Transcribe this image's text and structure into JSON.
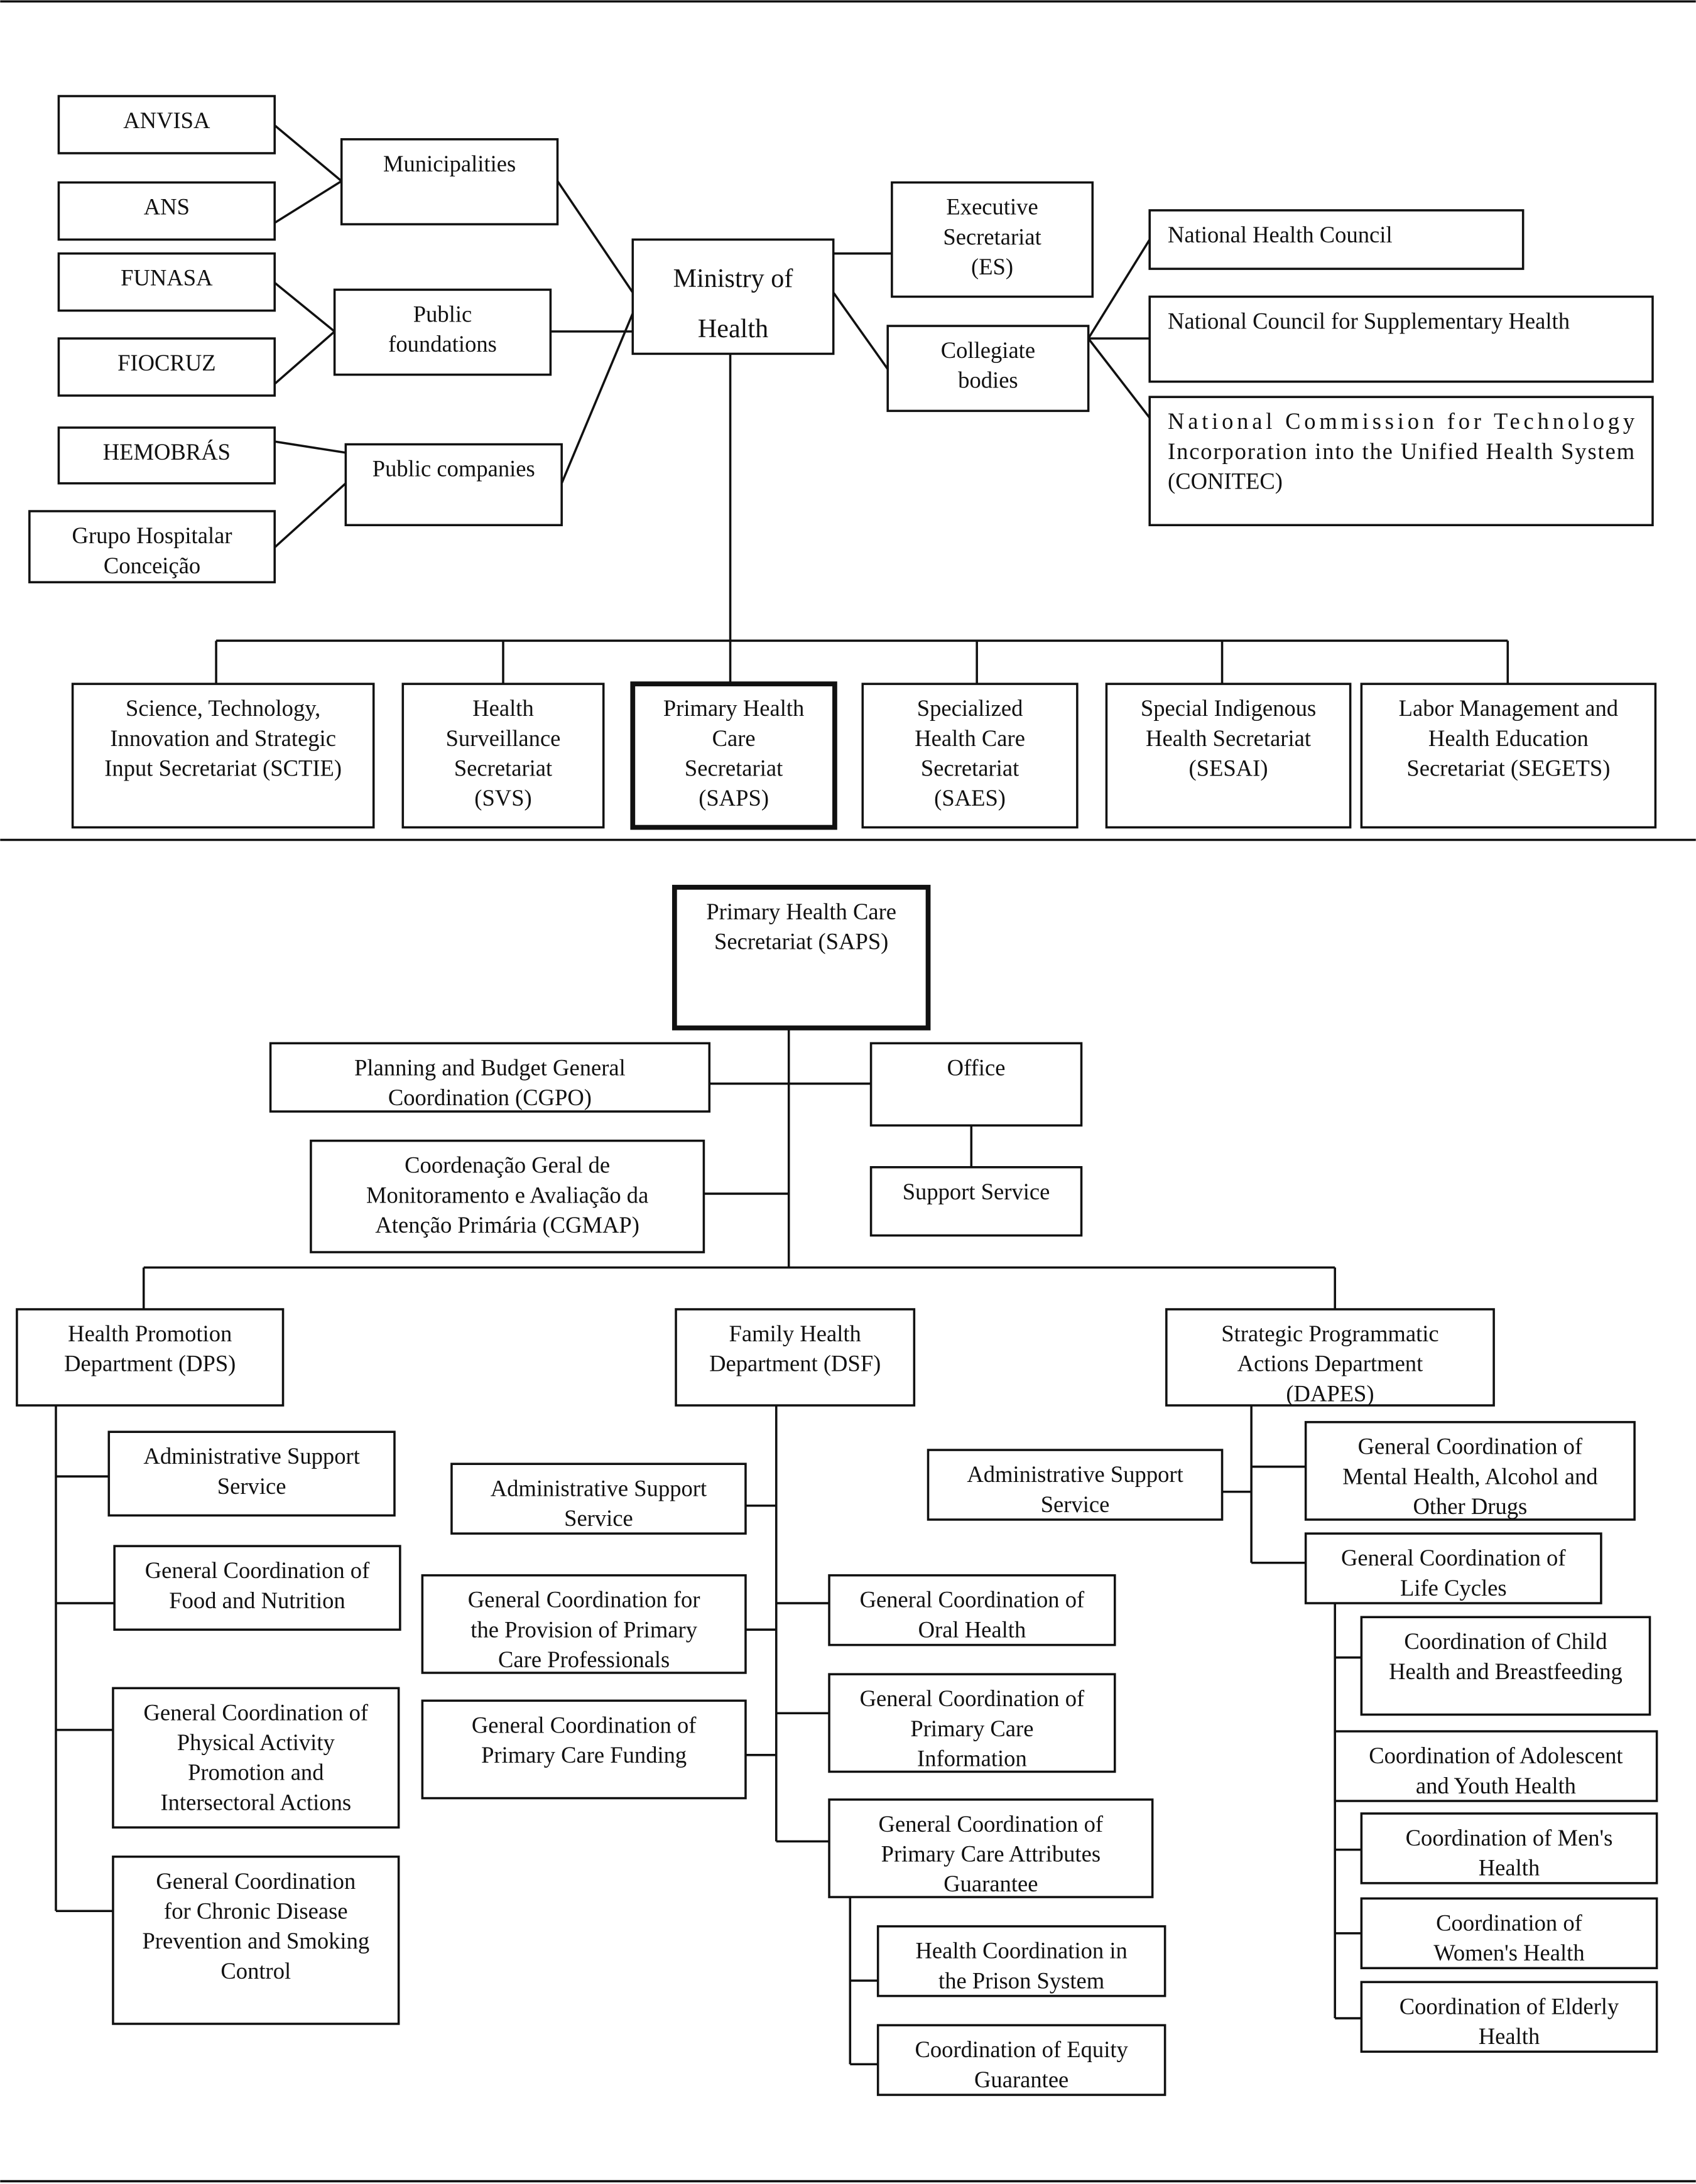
{
  "nodes": {
    "anvisa": [
      "ANVISA"
    ],
    "ans": [
      "ANS"
    ],
    "funasa": [
      "FUNASA"
    ],
    "fiocruz": [
      "FIOCRUZ"
    ],
    "hemobras": [
      "HEMOBRÁS"
    ],
    "ghc": [
      "Grupo Hospitalar",
      "Conceição"
    ],
    "municipalities": [
      "Municipalities"
    ],
    "public_foundations": [
      "Public",
      "foundations"
    ],
    "public_companies": [
      "Public companies"
    ],
    "ministry": [
      "Ministry of",
      "Health"
    ],
    "executive_secretariat": [
      "Executive",
      "Secretariat",
      "(ES)"
    ],
    "collegiate_bodies": [
      "Collegiate",
      "bodies"
    ],
    "national_health_council": [
      "National Health Council"
    ],
    "ncsh": [
      "National Council for Supplementary Health"
    ],
    "conitec": [
      "National Commission for Technology",
      "Incorporation into the Unified Health System",
      "(CONITEC)"
    ],
    "sctie": [
      "Science, Technology,",
      "Innovation and Strategic",
      "Input Secretariat (SCTIE)"
    ],
    "svs": [
      "Health",
      "Surveillance",
      "Secretariat",
      "(SVS)"
    ],
    "saps_top": [
      "Primary Health",
      "Care",
      "Secretariat",
      "(SAPS)"
    ],
    "saes": [
      "Specialized",
      "Health Care",
      "Secretariat",
      "(SAES)"
    ],
    "sesai": [
      "Special Indigenous",
      "Health Secretariat",
      "(SESAI)"
    ],
    "segets": [
      "Labor Management and",
      "Health Education",
      "Secretariat (SEGETS)"
    ],
    "saps": [
      "Primary Health Care",
      "Secretariat (SAPS)"
    ],
    "cgpo": [
      "Planning and Budget General",
      "Coordination (CGPO)"
    ],
    "office": [
      "Office"
    ],
    "cgmap": [
      "Coordenação Geral de",
      "Monitoramento e Avaliação da",
      "Atenção Primária (CGMAP)"
    ],
    "support_service": [
      "Support Service"
    ],
    "dps": [
      "Health Promotion",
      "Department (DPS)"
    ],
    "dsf": [
      "Family Health",
      "Department (DSF)"
    ],
    "dapes": [
      "Strategic Programmatic",
      "Actions Department",
      "(DAPES)"
    ],
    "dps_admin": [
      "Administrative Support",
      "Service"
    ],
    "dps_food": [
      "General Coordination of",
      "Food and Nutrition"
    ],
    "dps_physical": [
      "General Coordination of",
      "Physical Activity",
      "Promotion and",
      "Intersectoral Actions"
    ],
    "dps_chronic": [
      "General Coordination",
      "for Chronic Disease",
      "Prevention and Smoking",
      "Control"
    ],
    "dsf_admin": [
      "Administrative Support",
      "Service"
    ],
    "dsf_professionals": [
      "General Coordination for",
      "the Provision of Primary",
      "Care Professionals"
    ],
    "dsf_funding": [
      "General Coordination of",
      "Primary Care Funding"
    ],
    "dsf_oral": [
      "General Coordination of",
      "Oral Health"
    ],
    "dsf_info": [
      "General Coordination of",
      "Primary Care",
      "Information"
    ],
    "dsf_attributes": [
      "General Coordination of",
      "Primary Care Attributes",
      "Guarantee"
    ],
    "dsf_prison": [
      "Health Coordination in",
      "the Prison System"
    ],
    "dsf_equity": [
      "Coordination of Equity",
      "Guarantee"
    ],
    "dapes_admin": [
      "Administrative Support",
      "Service"
    ],
    "dapes_mental": [
      "General Coordination of",
      "Mental Health, Alcohol and",
      "Other Drugs"
    ],
    "dapes_lifecycles": [
      "General Coordination of",
      "Life Cycles"
    ],
    "dapes_child": [
      "Coordination of Child",
      "Health and Breastfeeding"
    ],
    "dapes_adolescent": [
      "Coordination of Adolescent",
      "and Youth Health"
    ],
    "dapes_men": [
      "Coordination of Men's",
      "Health"
    ],
    "dapes_women": [
      "Coordination of",
      "Women's Health"
    ],
    "dapes_elderly": [
      "Coordination of Elderly",
      "Health"
    ]
  },
  "highlighted": [
    "saps_top",
    "saps"
  ]
}
